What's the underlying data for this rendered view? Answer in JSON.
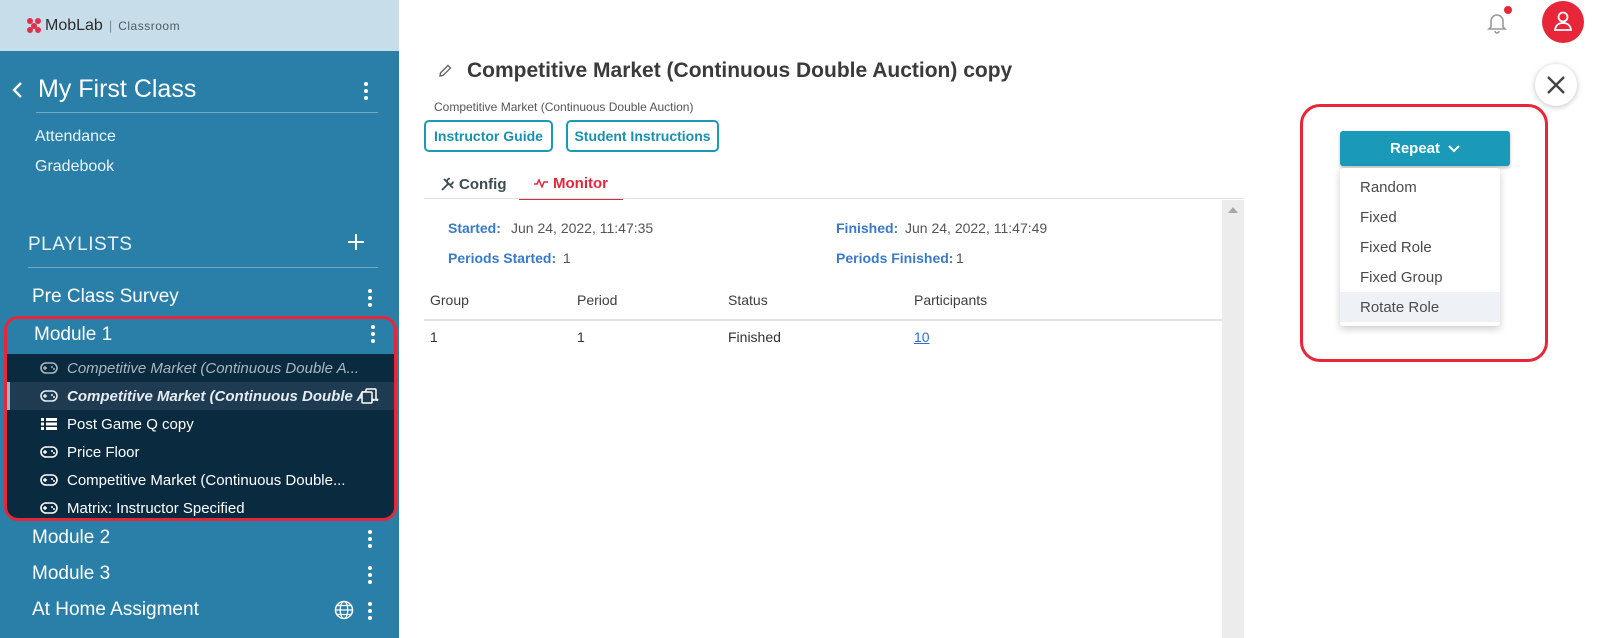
{
  "brand": {
    "name": "MobLab",
    "separator": "|",
    "product": "Classroom"
  },
  "sidebar": {
    "class_title": "My First Class",
    "nav": [
      "Attendance",
      "Gradebook"
    ],
    "playlists_label": "PLAYLISTS",
    "playlists": [
      {
        "label": "Pre Class Survey"
      },
      {
        "label": "Module 1"
      },
      {
        "label": "Module 2"
      },
      {
        "label": "Module 3"
      },
      {
        "label": "At Home Assigment"
      }
    ],
    "module1_items": [
      {
        "label": "Competitive Market (Continuous Double A...",
        "icon": "gamepad-icon"
      },
      {
        "label": "Competitive Market (Continuous Double A...",
        "icon": "gamepad-icon"
      },
      {
        "label": "Post Game Q copy",
        "icon": "list-icon"
      },
      {
        "label": "Price Floor",
        "icon": "gamepad-icon"
      },
      {
        "label": "Competitive Market (Continuous Double...",
        "icon": "gamepad-icon"
      },
      {
        "label": "Matrix: Instructor Specified",
        "icon": "gamepad-icon"
      }
    ]
  },
  "main": {
    "title": "Competitive Market (Continuous Double Auction) copy",
    "subtitle": "Competitive Market (Continuous Double Auction)",
    "buttons": {
      "instructor_guide": "Instructor Guide",
      "student_instructions": "Student Instructions"
    },
    "tabs": {
      "config": "Config",
      "monitor": "Monitor"
    },
    "meta": {
      "started_label": "Started:",
      "started_value": "Jun 24, 2022, 11:47:35",
      "finished_label": "Finished:",
      "finished_value": "Jun 24, 2022, 11:47:49",
      "periods_started_label": "Periods Started:",
      "periods_started_value": "1",
      "periods_finished_label": "Periods Finished:",
      "periods_finished_value": "1"
    },
    "table": {
      "headers": [
        "Group",
        "Period",
        "Status",
        "Participants"
      ],
      "rows": [
        [
          "1",
          "1",
          "Finished",
          "10"
        ]
      ]
    }
  },
  "repeat": {
    "button_label": "Repeat",
    "options": [
      "Random",
      "Fixed",
      "Fixed Role",
      "Fixed Group",
      "Rotate Role"
    ]
  },
  "colors": {
    "accent": "#1a99b8",
    "brand_red": "#e8263a",
    "sidebar": "#2a7fa8",
    "sidebar_dark": "#0a2a3f"
  }
}
